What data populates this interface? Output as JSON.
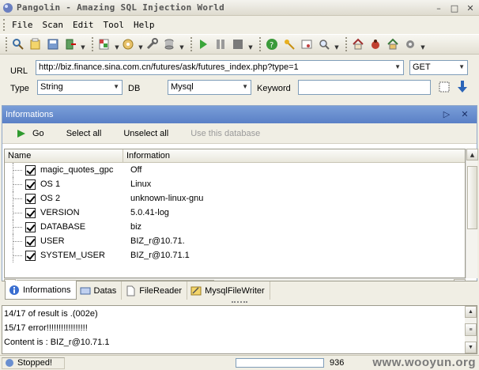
{
  "window": {
    "title": "Pangolin - Amazing SQL Injection World",
    "controls": [
      "minimize-icon",
      "maximize-icon",
      "close-icon"
    ]
  },
  "menu": [
    "File",
    "Scan",
    "Edit",
    "Tool",
    "Help"
  ],
  "toolbar_icons": [
    "search-icon",
    "open-file-icon",
    "save-icon",
    "exit-icon",
    "page-menu-icon",
    "config-menu-icon",
    "tools-icon",
    "database-icon",
    "play-icon",
    "pause-icon",
    "stop-icon",
    "help-icon",
    "key-icon",
    "certificate-icon",
    "magnifier-icon",
    "home-icon",
    "bug-icon",
    "lock-home-icon",
    "gear-icon"
  ],
  "params": {
    "url_label": "URL",
    "url_value": "http://biz.finance.sina.com.cn/futures/ask/futures_index.php?type=1",
    "method": "GET",
    "type_label": "Type",
    "type_value": "String",
    "db_label": "DB",
    "db_value": "Mysql",
    "keyword_label": "Keyword",
    "keyword_value": ""
  },
  "panel": {
    "title": "Informations",
    "actions": {
      "go": "Go",
      "select_all": "Select all",
      "unselect_all": "Unselect all",
      "use_db": "Use this database"
    },
    "columns": [
      "Name",
      "Information"
    ],
    "rows": [
      {
        "name": "magic_quotes_gpc",
        "info": "Off"
      },
      {
        "name": "OS 1",
        "info": "Linux"
      },
      {
        "name": "OS 2",
        "info": "unknown-linux-gnu"
      },
      {
        "name": "VERSION",
        "info": "5.0.41-log"
      },
      {
        "name": "DATABASE",
        "info": "biz"
      },
      {
        "name": "USER",
        "info": "BIZ_r@10.71."
      },
      {
        "name": "SYSTEM_USER",
        "info": "BIZ_r@10.71.1"
      }
    ]
  },
  "tabs": [
    "Informations",
    "Datas",
    "FileReader",
    "MysqlFileWriter"
  ],
  "log": [
    "14/17 of result is .(002e)",
    "15/17 error!!!!!!!!!!!!!!!!!",
    "Content is : BIZ_r@10.71.1"
  ],
  "status": {
    "text": "Stopped!",
    "count": "936",
    "watermark": "www.wooyun.org"
  },
  "colors": {
    "panel_header": "#6f93d3",
    "window_bg": "#f0eee4"
  }
}
